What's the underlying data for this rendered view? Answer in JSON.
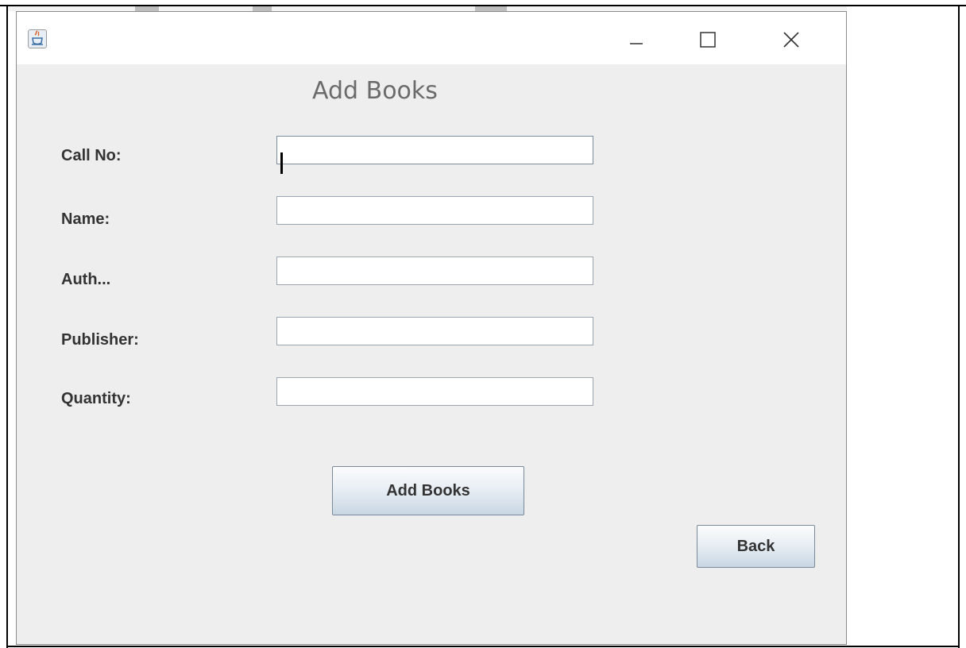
{
  "window": {
    "title": "",
    "controls": {
      "minimize": "minimize-icon",
      "maximize": "maximize-icon",
      "close": "close-icon"
    }
  },
  "form": {
    "heading": "Add Books",
    "fields": [
      {
        "label": "Call No:",
        "value": ""
      },
      {
        "label": "Name:",
        "value": ""
      },
      {
        "label": "Auth...",
        "value": ""
      },
      {
        "label": "Publisher:",
        "value": ""
      },
      {
        "label": "Quantity:",
        "value": ""
      }
    ],
    "add_button": "Add Books",
    "back_button": "Back"
  },
  "colors": {
    "window_bg": "#eeeeee",
    "heading": "#6b6b6b",
    "label": "#333333",
    "field_border": "#9aa6b2"
  }
}
